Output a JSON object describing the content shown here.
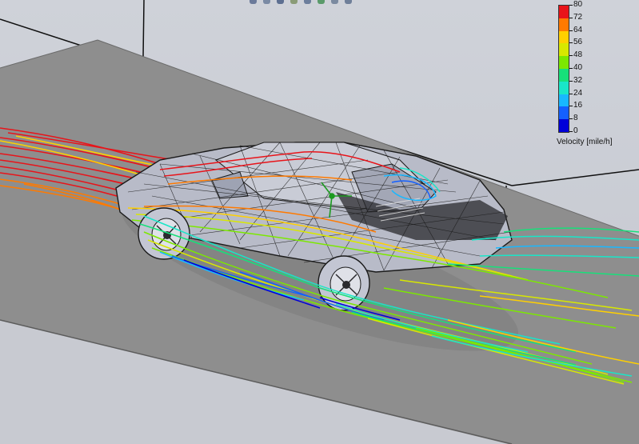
{
  "legend": {
    "title": "Velocity [mile/h]",
    "ticks": [
      "80",
      "72",
      "64",
      "56",
      "48",
      "40",
      "32",
      "24",
      "16",
      "8",
      "0"
    ],
    "colors": [
      "#e8141a",
      "#ff7a00",
      "#ffd000",
      "#d8e800",
      "#7ce800",
      "#17e07a",
      "#19e6c8",
      "#18b8ff",
      "#1460ff",
      "#0000d8"
    ]
  },
  "colors": {
    "background": "#c9ccd3",
    "floor": "#8f8f8f",
    "floor_edge": "#5c5c5c",
    "car_body": "#b9bcc9",
    "mesh": "#1a1a1a"
  },
  "toolbar_icons": [
    "view-icon",
    "zoom-icon",
    "rotate-icon",
    "pan-icon",
    "display-icon",
    "section-icon",
    "light-icon",
    "camera-icon"
  ]
}
